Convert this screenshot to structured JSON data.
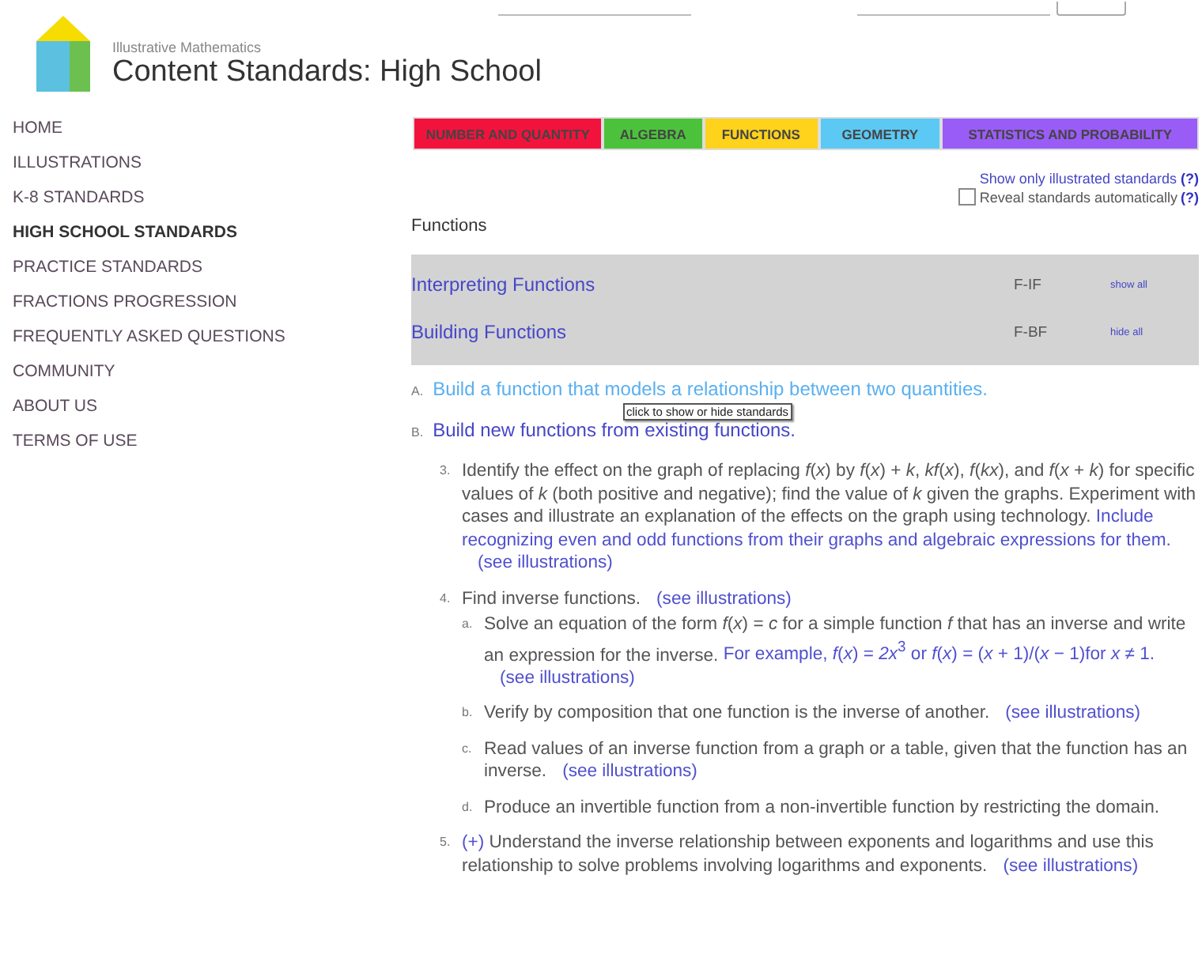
{
  "header": {
    "site": "Illustrative Mathematics",
    "title": "Content Standards: High School"
  },
  "nav": [
    {
      "label": "HOME",
      "selected": false
    },
    {
      "label": "ILLUSTRATIONS",
      "selected": false
    },
    {
      "label": "K-8 STANDARDS",
      "selected": false
    },
    {
      "label": "HIGH SCHOOL STANDARDS",
      "selected": true
    },
    {
      "label": "PRACTICE STANDARDS",
      "selected": false
    },
    {
      "label": "FRACTIONS PROGRESSION",
      "selected": false
    },
    {
      "label": "FREQUENTLY ASKED QUESTIONS",
      "selected": false
    },
    {
      "label": "COMMUNITY",
      "selected": false
    },
    {
      "label": "ABOUT US",
      "selected": false
    },
    {
      "label": "TERMS OF USE",
      "selected": false
    }
  ],
  "tabs": [
    {
      "label": "NUMBER AND QUANTITY",
      "color": "#f2133c"
    },
    {
      "label": "ALGEBRA",
      "color": "#4cc23c"
    },
    {
      "label": "FUNCTIONS",
      "color": "#ffd21c"
    },
    {
      "label": "GEOMETRY",
      "color": "#5cc8f4"
    },
    {
      "label": "STATISTICS AND PROBABILITY",
      "color": "#9a5cf6"
    }
  ],
  "options": {
    "illustrated_link": "Show only illustrated standards",
    "help": "(?)",
    "reveal_label": "Reveal standards automatically",
    "reveal_checked": false,
    "reveal_help": "(?)"
  },
  "section_title": "Functions",
  "domains": [
    {
      "name": "Interpreting Functions",
      "code": "F-IF",
      "action": "show all"
    },
    {
      "name": "Building Functions",
      "code": "F-BF",
      "action": "hide all"
    }
  ],
  "clusters": [
    {
      "letter": "A.",
      "title": "Build a function that models a relationship between two quantities.",
      "expanded": false
    },
    {
      "letter": "B.",
      "title": "Build new functions from existing functions.",
      "expanded": true
    }
  ],
  "tooltip": "click to show or hide standards",
  "standards": [
    {
      "number": "3.",
      "text": "Identify the effect on the graph of replacing *f*(*x*) by *f*(*x*) + *k*, *kf*(*x*), *f*(*kx*), and *f*(*x* + *k*) for specific values of *k* (both positive and negative); find the value of *k* given the graphs. Experiment with cases and illustrate an explanation of the effects on the graph using technology.",
      "note": "Include recognizing even and odd functions from their graphs and algebraic expressions for them.",
      "link": "(see illustrations)"
    },
    {
      "number": "4.",
      "text": "Find inverse functions.",
      "link": "(see illustrations)",
      "children": [
        {
          "number": "a.",
          "text": "Solve an equation of the form *f*(*x*) = *c* for a simple function *f* that has an inverse and write an expression for the inverse.",
          "note": "For example, *f*(*x*) = *2x*$^{3}$ or *f*(*x*) = (*x* + 1)/(*x* − 1)for *x* ≠ 1.",
          "link": "(see illustrations)"
        },
        {
          "number": "b.",
          "text": "Verify by composition that one function is the inverse of another.",
          "link": "(see illustrations)"
        },
        {
          "number": "c.",
          "text": "Read values of an inverse function from a graph or a table, given that the function has an inverse.",
          "link": "(see illustrations)"
        },
        {
          "number": "d.",
          "text": "Produce an invertible function from a non-invertible function by restricting the domain."
        }
      ]
    },
    {
      "number": "5.",
      "prefix": "(+)",
      "text": "Understand the inverse relationship between exponents and logarithms and use this relationship to solve problems involving logarithms and exponents.",
      "link": "(see illustrations)"
    }
  ]
}
